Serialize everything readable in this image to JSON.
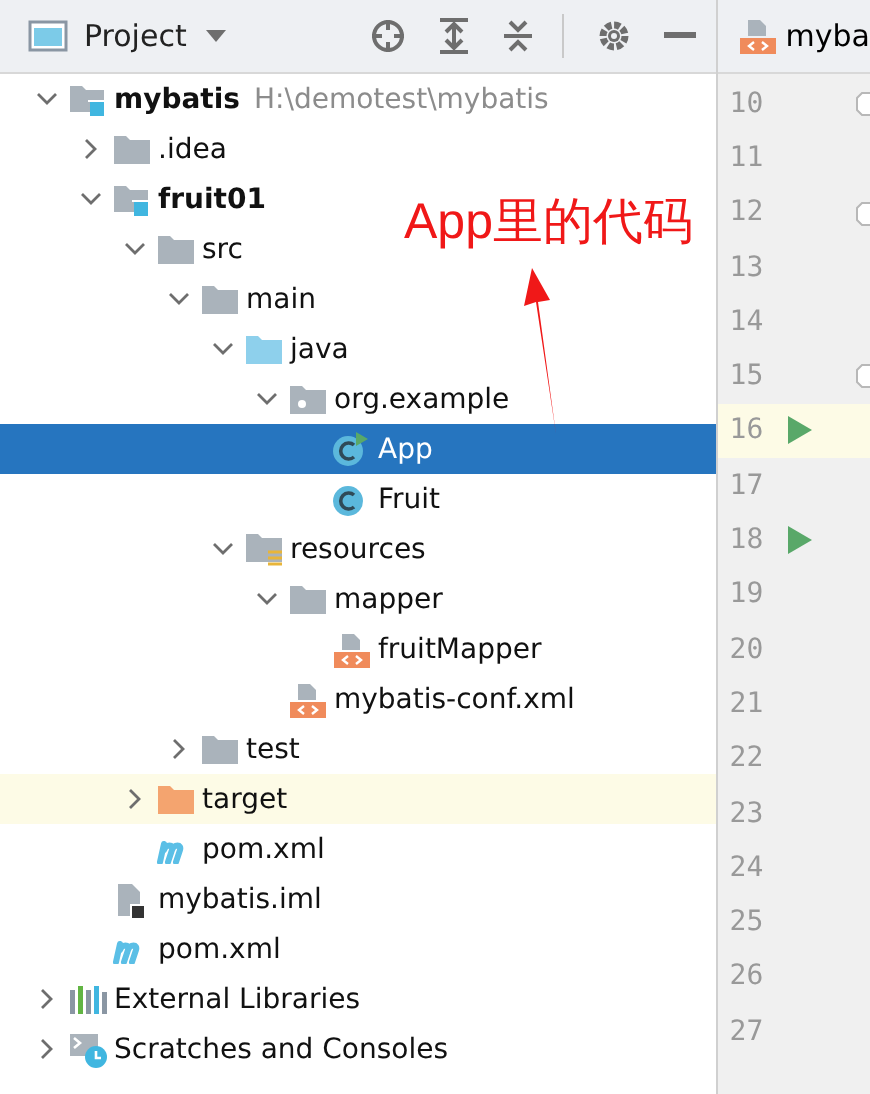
{
  "panel": {
    "title": "Project"
  },
  "editor_tab": {
    "title": "myba"
  },
  "tree": [
    {
      "label": "mybatis",
      "hint": "H:\\demotest\\mybatis",
      "kind": "module",
      "bold": true,
      "expanded": true,
      "selected": false,
      "highlighted": false,
      "children": [
        {
          "label": ".idea",
          "kind": "folder",
          "bold": false,
          "expanded": false,
          "selected": false,
          "highlighted": false
        },
        {
          "label": "fruit01",
          "kind": "module",
          "bold": true,
          "expanded": true,
          "selected": false,
          "highlighted": false,
          "children": [
            {
              "label": "src",
              "kind": "folder",
              "bold": false,
              "expanded": true,
              "selected": false,
              "highlighted": false,
              "children": [
                {
                  "label": "main",
                  "kind": "folder",
                  "bold": false,
                  "expanded": true,
                  "selected": false,
                  "highlighted": false,
                  "children": [
                    {
                      "label": "java",
                      "kind": "source-folder",
                      "bold": false,
                      "expanded": true,
                      "selected": false,
                      "highlighted": false,
                      "children": [
                        {
                          "label": "org.example",
                          "kind": "package",
                          "bold": false,
                          "expanded": true,
                          "selected": false,
                          "highlighted": false,
                          "children": [
                            {
                              "label": "App",
                              "kind": "class-run",
                              "bold": false,
                              "selected": true,
                              "highlighted": false
                            },
                            {
                              "label": "Fruit",
                              "kind": "class",
                              "bold": false,
                              "selected": false,
                              "highlighted": false
                            }
                          ]
                        }
                      ]
                    },
                    {
                      "label": "resources",
                      "kind": "resources-folder",
                      "bold": false,
                      "expanded": true,
                      "selected": false,
                      "highlighted": false,
                      "children": [
                        {
                          "label": "mapper",
                          "kind": "folder",
                          "bold": false,
                          "expanded": true,
                          "selected": false,
                          "highlighted": false,
                          "children": [
                            {
                              "label": "fruitMapper",
                              "kind": "xml",
                              "bold": false,
                              "selected": false,
                              "highlighted": false
                            }
                          ]
                        },
                        {
                          "label": "mybatis-conf.xml",
                          "kind": "xml",
                          "bold": false,
                          "selected": false,
                          "highlighted": false
                        }
                      ]
                    }
                  ]
                },
                {
                  "label": "test",
                  "kind": "folder",
                  "bold": false,
                  "expanded": false,
                  "selected": false,
                  "highlighted": false
                }
              ]
            },
            {
              "label": "target",
              "kind": "excluded-folder",
              "bold": false,
              "expanded": false,
              "selected": false,
              "highlighted": true
            },
            {
              "label": "pom.xml",
              "kind": "maven",
              "bold": false,
              "selected": false,
              "highlighted": false
            }
          ]
        },
        {
          "label": "mybatis.iml",
          "kind": "iml",
          "bold": false,
          "selected": false,
          "highlighted": false
        },
        {
          "label": "pom.xml",
          "kind": "maven",
          "bold": false,
          "selected": false,
          "highlighted": false
        }
      ]
    },
    {
      "label": "External Libraries",
      "kind": "libraries",
      "bold": false,
      "expanded": false,
      "selected": false,
      "highlighted": false
    },
    {
      "label": "Scratches and Consoles",
      "kind": "scratches",
      "bold": false,
      "expanded": false,
      "selected": false,
      "highlighted": false
    }
  ],
  "gutter": [
    {
      "number": "10",
      "run": false,
      "fold": true,
      "current": false
    },
    {
      "number": "11",
      "run": false,
      "fold": false,
      "current": false
    },
    {
      "number": "12",
      "run": false,
      "fold": true,
      "current": false
    },
    {
      "number": "13",
      "run": false,
      "fold": false,
      "current": false
    },
    {
      "number": "14",
      "run": false,
      "fold": false,
      "current": false
    },
    {
      "number": "15",
      "run": false,
      "fold": true,
      "current": false
    },
    {
      "number": "16",
      "run": true,
      "fold": false,
      "current": true
    },
    {
      "number": "17",
      "run": false,
      "fold": false,
      "current": false
    },
    {
      "number": "18",
      "run": true,
      "fold": false,
      "current": false
    },
    {
      "number": "19",
      "run": false,
      "fold": false,
      "current": false
    },
    {
      "number": "20",
      "run": false,
      "fold": false,
      "current": false
    },
    {
      "number": "21",
      "run": false,
      "fold": false,
      "current": false
    },
    {
      "number": "22",
      "run": false,
      "fold": false,
      "current": false
    },
    {
      "number": "23",
      "run": false,
      "fold": false,
      "current": false
    },
    {
      "number": "24",
      "run": false,
      "fold": false,
      "current": false
    },
    {
      "number": "25",
      "run": false,
      "fold": false,
      "current": false
    },
    {
      "number": "26",
      "run": false,
      "fold": false,
      "current": false
    },
    {
      "number": "27",
      "run": false,
      "fold": false,
      "current": false
    }
  ],
  "annotation": {
    "text": "App里的代码"
  }
}
